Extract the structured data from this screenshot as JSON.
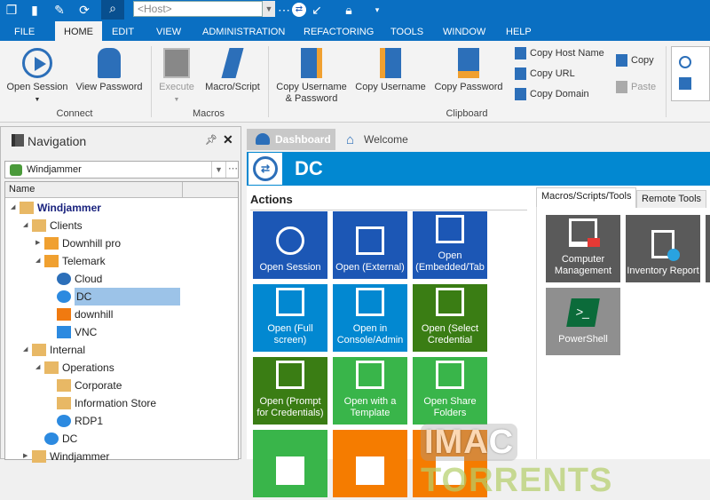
{
  "toolbar": {
    "host_placeholder": "<Host>"
  },
  "ribbon_tabs": [
    "FILE",
    "HOME",
    "EDIT",
    "VIEW",
    "ADMINISTRATION",
    "REFACTORING",
    "TOOLS",
    "WINDOW",
    "HELP"
  ],
  "ribbon": {
    "connect": {
      "label": "Connect",
      "open_session": "Open Session",
      "view_password": "View Password"
    },
    "macros": {
      "label": "Macros",
      "execute": "Execute",
      "macro_script": "Macro/Script"
    },
    "clipboard": {
      "label": "Clipboard",
      "copy_user_pass": "Copy Username & Password",
      "copy_username": "Copy Username",
      "copy_password": "Copy Password",
      "copy_host": "Copy Host Name",
      "copy_url": "Copy URL",
      "copy_domain": "Copy Domain",
      "copy": "Copy",
      "paste": "Paste"
    }
  },
  "navigation": {
    "title": "Navigation",
    "vault": "Windjammer",
    "column": "Name",
    "tree": [
      {
        "label": "Windjammer",
        "icon": "folder-icon",
        "bold": true
      },
      {
        "label": "Clients",
        "icon": "folder-icon"
      },
      {
        "label": "Downhill pro",
        "icon": "user-icon"
      },
      {
        "label": "Telemark",
        "icon": "user-icon"
      },
      {
        "label": "Cloud",
        "icon": "globe-icon"
      },
      {
        "label": "DC",
        "icon": "rdp-icon",
        "selected": true
      },
      {
        "label": "downhill",
        "icon": "key-icon"
      },
      {
        "label": "VNC",
        "icon": "vnc-icon"
      },
      {
        "label": "Internal",
        "icon": "building-icon"
      },
      {
        "label": "Operations",
        "icon": "briefcase-icon"
      },
      {
        "label": "Corporate",
        "icon": "briefcase-icon"
      },
      {
        "label": "Information Store",
        "icon": "folder-icon"
      },
      {
        "label": "RDP1",
        "icon": "rdp-icon"
      },
      {
        "label": "DC",
        "icon": "rdp-icon"
      },
      {
        "label": "Windjammer",
        "icon": "building-icon"
      }
    ]
  },
  "doc_tabs": {
    "dashboard": "Dashboard",
    "welcome": "Welcome"
  },
  "entry": {
    "title": "DC"
  },
  "actions": {
    "title": "Actions",
    "tiles": [
      {
        "label": "Open Session",
        "color": "#1c57b5"
      },
      {
        "label": "Open (External)",
        "color": "#1c57b5"
      },
      {
        "label": "Open (Embedded/Tab",
        "color": "#1c57b5"
      },
      {
        "label": "Open (Full screen)",
        "color": "#0288d1"
      },
      {
        "label": "Open in Console/Admin",
        "color": "#0288d1"
      },
      {
        "label": "Open (Select Credential",
        "color": "#3a7d14"
      },
      {
        "label": "Open (Prompt for Credentials)",
        "color": "#3a7d14"
      },
      {
        "label": "Open with a Template",
        "color": "#39b54a"
      },
      {
        "label": "Open Share Folders",
        "color": "#39b54a"
      },
      {
        "label": "",
        "color": "#39b54a"
      },
      {
        "label": "",
        "color": "#f57c00"
      },
      {
        "label": "",
        "color": "#f57c00"
      }
    ]
  },
  "tools": {
    "tabs": [
      "Macros/Scripts/Tools",
      "Remote Tools"
    ],
    "tiles": [
      {
        "label": "Computer Management"
      },
      {
        "label": "Inventory Report"
      },
      {
        "label": "PowerShell"
      }
    ]
  },
  "watermark": {
    "text1": "IMAC",
    "text2": "TORRENTS"
  }
}
